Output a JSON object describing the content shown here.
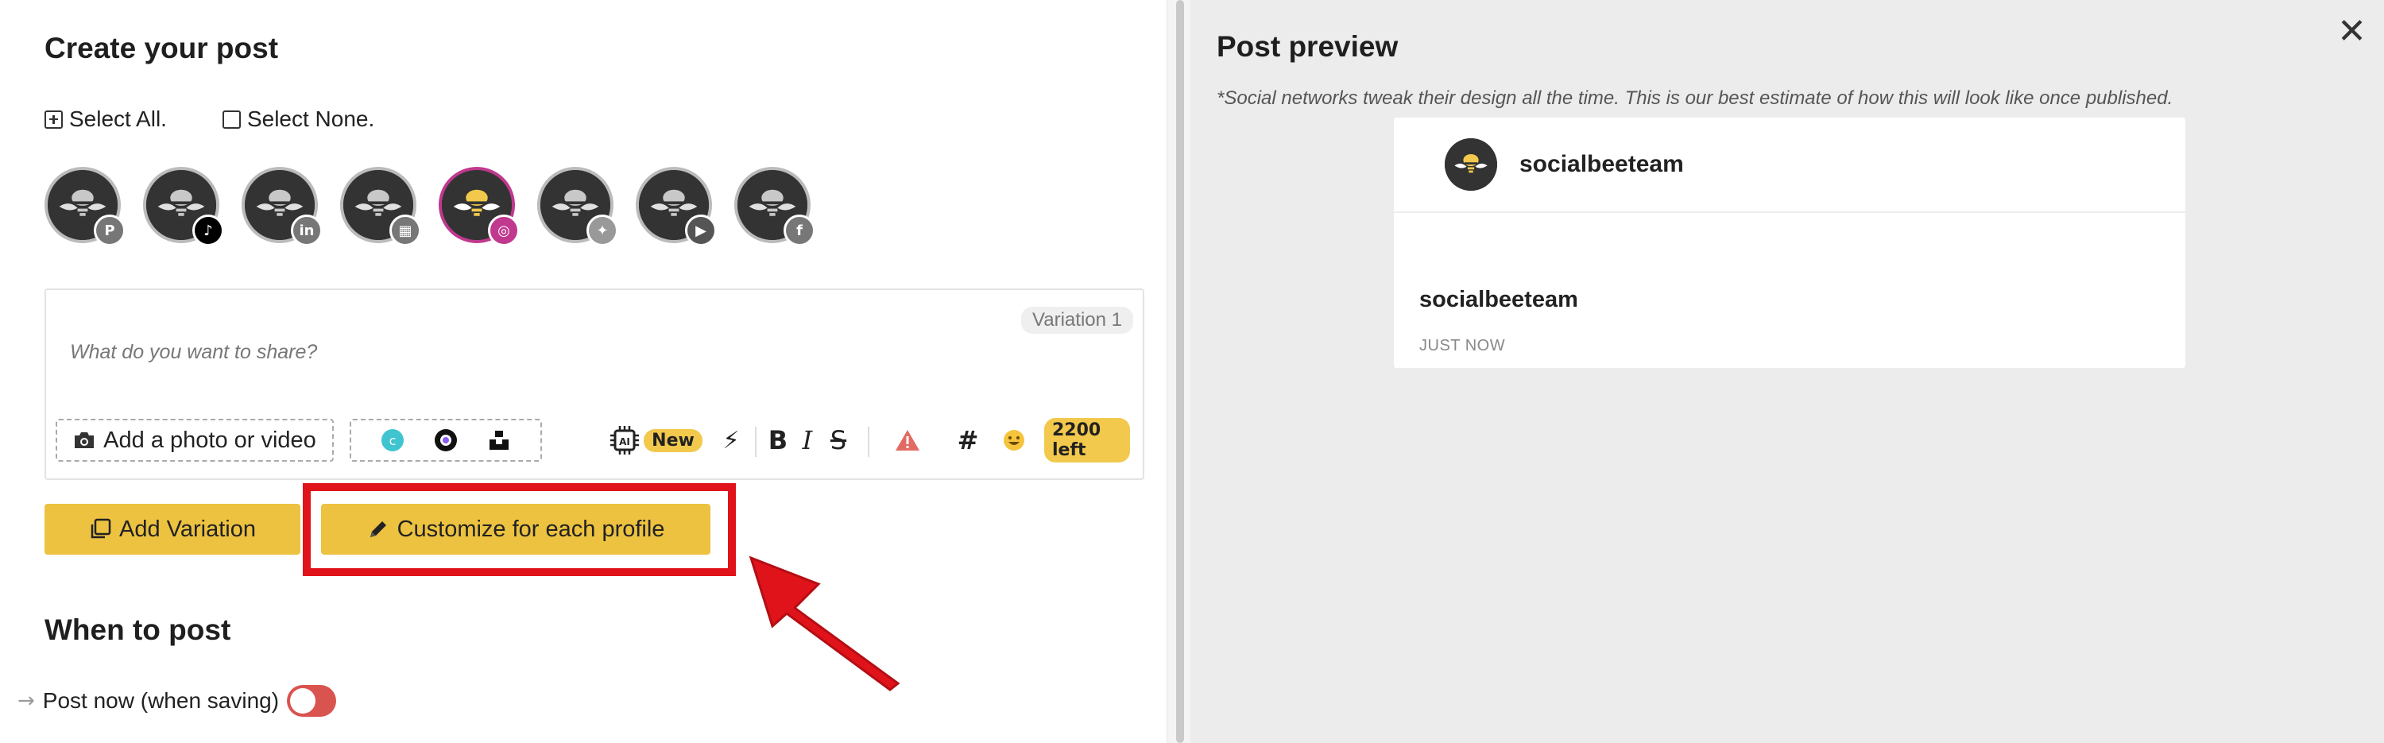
{
  "editor": {
    "title": "Create your post",
    "select_all": "Select All.",
    "select_none": "Select None.",
    "profiles": [
      {
        "network": "pinterest",
        "badge_color": "#777777",
        "badge_glyph": "P",
        "selected": false
      },
      {
        "network": "tiktok",
        "badge_color": "#000000",
        "badge_glyph": "♪",
        "selected": false
      },
      {
        "network": "linkedin",
        "badge_color": "#777777",
        "badge_glyph": "in",
        "selected": false
      },
      {
        "network": "google-business",
        "badge_color": "#777777",
        "badge_glyph": "▦",
        "selected": false
      },
      {
        "network": "instagram",
        "badge_color": "#c0398e",
        "badge_glyph": "◎",
        "selected": true
      },
      {
        "network": "twitter",
        "badge_color": "#999999",
        "badge_glyph": "✦",
        "selected": false
      },
      {
        "network": "youtube",
        "badge_color": "#555555",
        "badge_glyph": "▶",
        "selected": false
      },
      {
        "network": "facebook",
        "badge_color": "#777777",
        "badge_glyph": "f",
        "selected": false
      }
    ],
    "variation_tag": "Variation 1",
    "placeholder": "What do you want to share?",
    "add_media_label": "Add a photo or video",
    "ai_new_badge": "New",
    "chars_left": "2200 left",
    "add_variation_label": "Add Variation",
    "customize_label": "Customize for each profile",
    "when_title": "When to post",
    "post_now_label": "Post now (when saving)"
  },
  "preview": {
    "title": "Post preview",
    "note": "*Social networks tweak their design all the time. This is our best estimate of how this will look like once published.",
    "account_name": "socialbeeteam",
    "caption_name": "socialbeeteam",
    "timestamp": "JUST NOW"
  },
  "colors": {
    "accent_yellow": "#ecc240",
    "highlight_red": "#e1131a",
    "toggle_off_red": "#d9534f",
    "instagram_pink": "#c0398e"
  }
}
